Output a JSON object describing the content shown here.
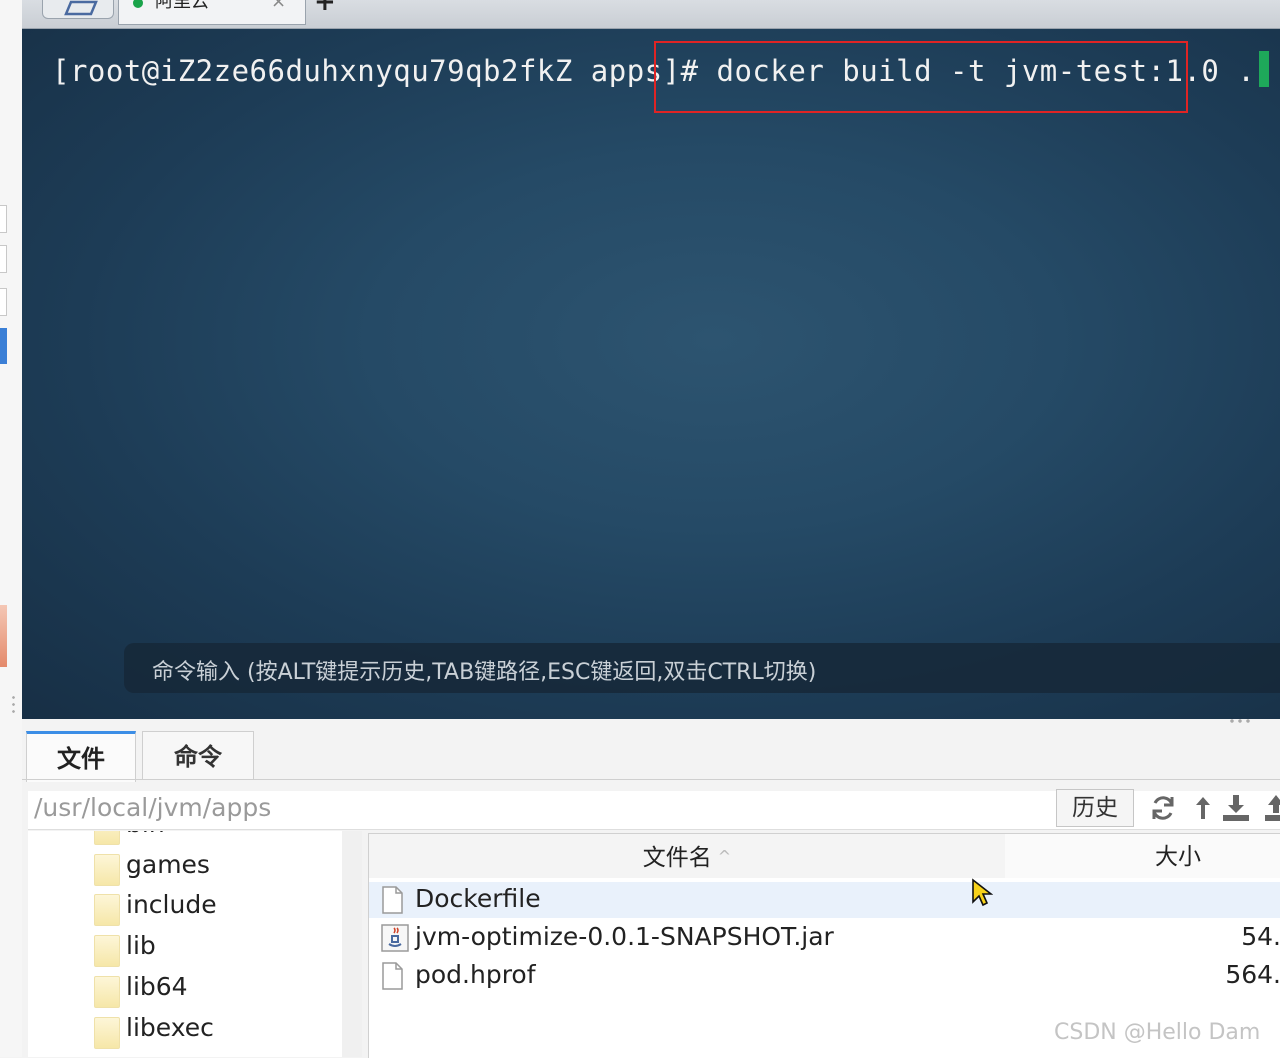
{
  "tabs": {
    "session_title": "阿里云",
    "close_glyph": "×",
    "add_glyph": "+"
  },
  "terminal": {
    "prompt": "[root@iZ2ze66duhxnyqu79qb2fkZ apps]# ",
    "command": "docker build -t jvm-test:1.0 .",
    "input_hint": "命令输入 (按ALT键提示历史,TAB键路径,ESC键返回,双击CTRL切换)",
    "highlight_color": "#e02424",
    "cursor_color": "#1ea85a"
  },
  "panel": {
    "tab_files": "文件",
    "tab_commands": "命令",
    "path": "/usr/local/jvm/apps",
    "history_button": "历史",
    "icons": [
      "refresh-icon",
      "up-dir-icon",
      "download-icon",
      "upload-icon"
    ]
  },
  "tree": {
    "items": [
      "bin",
      "games",
      "include",
      "lib",
      "lib64",
      "libexec"
    ]
  },
  "file_list": {
    "col_name": "文件名",
    "col_size": "大小",
    "sort_glyph": "^",
    "rows": [
      {
        "name": "Dockerfile",
        "size": "",
        "icon": "file-icon"
      },
      {
        "name": "jvm-optimize-0.0.1-SNAPSHOT.jar",
        "size": "54.",
        "icon": "java-jar-icon"
      },
      {
        "name": "pod.hprof",
        "size": "564.",
        "icon": "file-icon"
      }
    ]
  },
  "watermark": "CSDN @Hello Dam"
}
